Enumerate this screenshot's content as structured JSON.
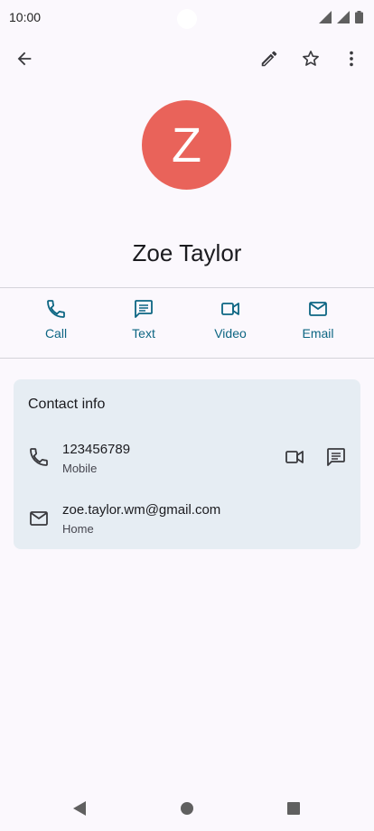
{
  "status_bar": {
    "time": "10:00"
  },
  "contact": {
    "initial": "Z",
    "name": "Zoe Taylor",
    "avatar_color": "#e9635a"
  },
  "actions": [
    {
      "label": "Call",
      "icon": "phone-icon"
    },
    {
      "label": "Text",
      "icon": "message-icon"
    },
    {
      "label": "Video",
      "icon": "video-icon"
    },
    {
      "label": "Email",
      "icon": "email-icon"
    }
  ],
  "contact_info": {
    "title": "Contact info",
    "phone": {
      "number": "123456789",
      "type": "Mobile"
    },
    "email": {
      "address": "zoe.taylor.wm@gmail.com",
      "type": "Home"
    }
  },
  "colors": {
    "accent": "#0d6683",
    "card": "#e6edf3"
  }
}
